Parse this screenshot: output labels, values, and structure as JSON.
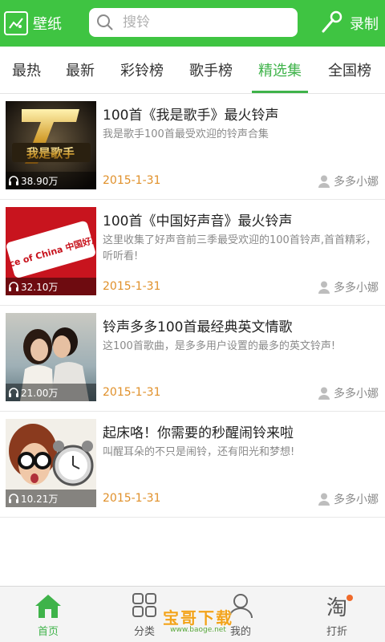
{
  "header": {
    "wallpaper_label": "壁纸",
    "search_placeholder": "搜铃",
    "record_label": "录制"
  },
  "tabs": [
    {
      "label": "最热",
      "active": false
    },
    {
      "label": "最新",
      "active": false
    },
    {
      "label": "彩铃榜",
      "active": false
    },
    {
      "label": "歌手榜",
      "active": false
    },
    {
      "label": "精选集",
      "active": true
    },
    {
      "label": "全国榜",
      "active": false
    }
  ],
  "items": [
    {
      "title": "100首《我是歌手》最火铃声",
      "desc": "我是歌手100首最受欢迎的铃声合集",
      "plays": "38.90万",
      "date": "2015-1-31",
      "author": "多多小娜",
      "thumb_art": "我是歌手"
    },
    {
      "title": "100首《中国好声音》最火铃声",
      "desc": "这里收集了好声音前三季最受欢迎的100首铃声,首首精彩，听听看!",
      "plays": "32.10万",
      "date": "2015-1-31",
      "author": "多多小娜",
      "thumb_art": "Voice of China 中国好声音"
    },
    {
      "title": "铃声多多100首最经典英文情歌",
      "desc": "这100首歌曲，是多多用户设置的最多的英文铃声!",
      "plays": "21.00万",
      "date": "2015-1-31",
      "author": "多多小娜",
      "thumb_art": ""
    },
    {
      "title": "起床咯！你需要的秒醒闹铃来啦",
      "desc": "叫醒耳朵的不只是闹铃，还有阳光和梦想!",
      "plays": "10.21万",
      "date": "2015-1-31",
      "author": "多多小娜",
      "thumb_art": ""
    }
  ],
  "bottom_nav": [
    {
      "label": "首页",
      "icon": "home-icon",
      "active": true
    },
    {
      "label": "分类",
      "icon": "grid-icon",
      "active": false
    },
    {
      "label": "我的",
      "icon": "user-icon",
      "active": false
    },
    {
      "label": "打折",
      "icon": "taobao-icon",
      "active": false
    }
  ],
  "watermark": {
    "main": "宝哥下载",
    "url": "www.baoge.net"
  },
  "colors": {
    "brand_green": "#3fc442",
    "active_tab_green": "#3fb34a",
    "date_orange": "#e0902a"
  }
}
